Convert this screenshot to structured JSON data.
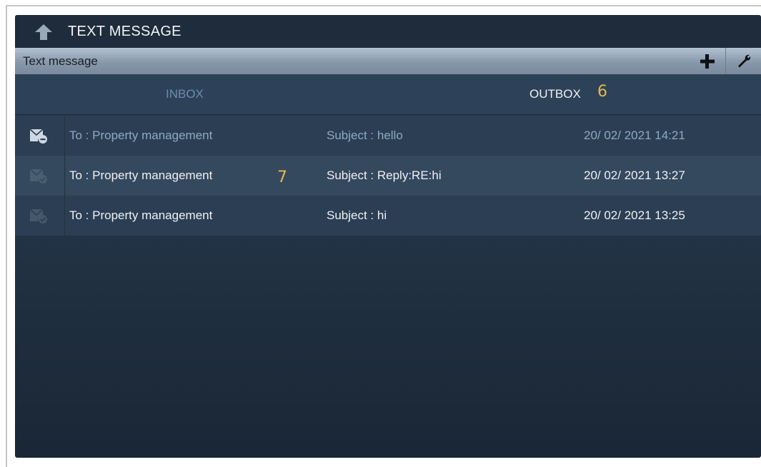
{
  "header": {
    "title": "TEXT MESSAGE",
    "back_icon": "back-arrow-icon"
  },
  "subbar": {
    "title": "Text message",
    "add_icon": "plus-icon",
    "settings_icon": "wrench-icon"
  },
  "tabs": [
    {
      "label": "INBOX",
      "active": false,
      "color": "#6d8ca8"
    },
    {
      "label": "OUTBOX",
      "active": true,
      "color": "#eef1f5"
    }
  ],
  "callouts": {
    "outbox": "6",
    "row": "7",
    "color": "#e6b84e"
  },
  "messages": [
    {
      "to": "To : Property management",
      "subject": "Subject : hello",
      "datetime": "20/ 02/ 2021 14:21",
      "icon": "mail-sending-icon",
      "state": "unread"
    },
    {
      "to": "To : Property management",
      "subject": "Subject : Reply:RE:hi",
      "datetime": "20/ 02/ 2021 13:27",
      "icon": "mail-sent-icon",
      "state": "read"
    },
    {
      "to": "To : Property management",
      "subject": "Subject : hi",
      "datetime": "20/ 02/ 2021 13:25",
      "icon": "mail-sent-icon",
      "state": "read"
    }
  ]
}
